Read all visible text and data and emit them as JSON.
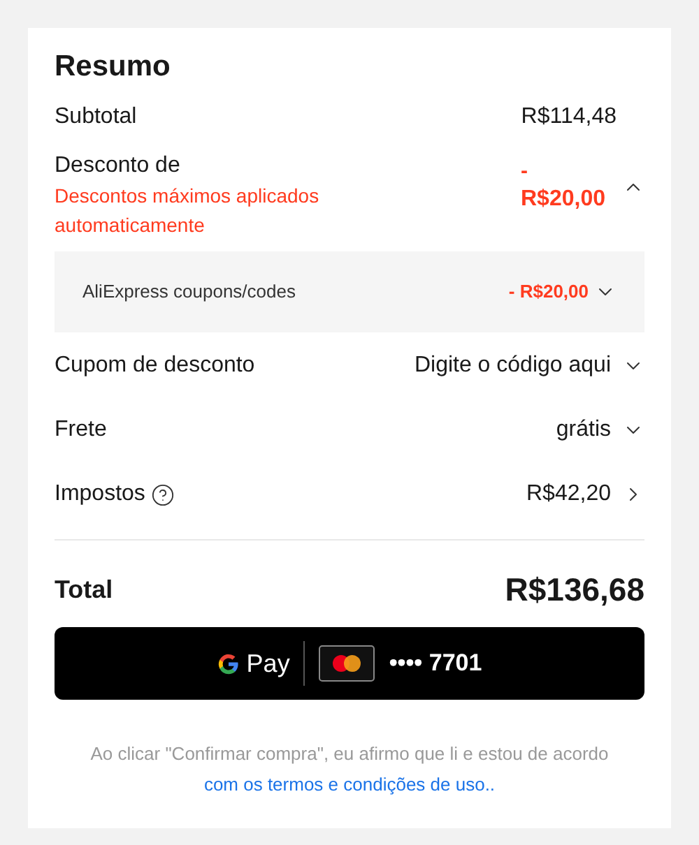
{
  "title": "Resumo",
  "subtotal": {
    "label": "Subtotal",
    "value": "R$114,48"
  },
  "discount": {
    "label": "Desconto de",
    "note": "Descontos máximos aplicados automaticamente",
    "value_prefix": "-",
    "value": "R$20,00",
    "expanded": true,
    "items": [
      {
        "label": "AliExpress coupons/codes",
        "value": "- R$20,00",
        "expanded": false
      }
    ]
  },
  "rows": [
    {
      "label": "Cupom de desconto",
      "value": "Digite o código aqui",
      "kind": "dropdown",
      "help": false
    },
    {
      "label": "Frete",
      "value": "grátis",
      "kind": "dropdown",
      "help": false
    },
    {
      "label": "Impostos",
      "value": "R$42,20",
      "kind": "link",
      "help": true
    }
  ],
  "total": {
    "label": "Total",
    "value": "R$136,68"
  },
  "pay_button": {
    "wallet": "Pay",
    "card_number": "•••• 7701"
  },
  "disclaimer": {
    "text": "Ao clicar \"Confirmar compra\", eu afirmo que li e estou de acordo",
    "link": "com os termos e condições de uso.."
  }
}
